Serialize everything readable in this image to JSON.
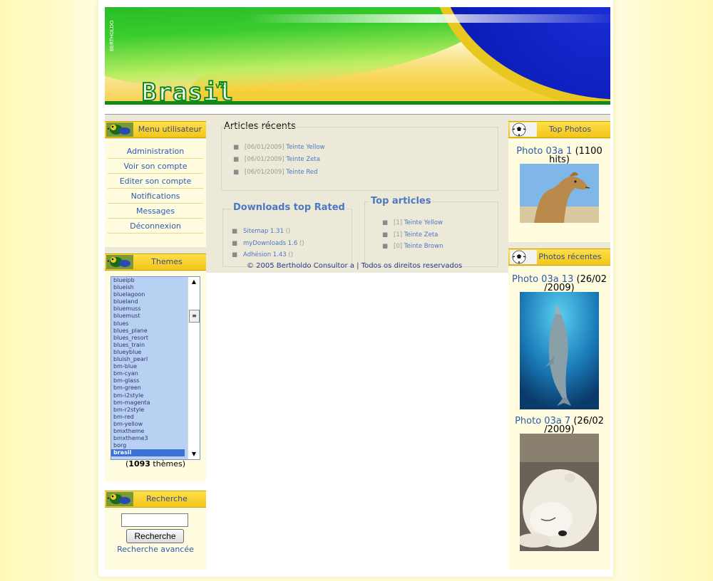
{
  "header": {
    "title": "Brasil",
    "version": "v2",
    "vertical_brand": "BERTHOLDO"
  },
  "user_menu": {
    "title": "Menu utilisateur",
    "items": [
      "Administration",
      "Voir son compte",
      "Editer son compte",
      "Notifications",
      "Messages",
      "Déconnexion"
    ]
  },
  "themes": {
    "title": "Themes",
    "options": [
      "blueipb",
      "blueish",
      "bluelagoon",
      "blueland",
      "bluemuss",
      "bluemust",
      "blues",
      "blues_plane",
      "blues_resort",
      "blues_train",
      "blueyblue",
      "bluish_pearl",
      "bm-blue",
      "bm-cyan",
      "bm-glass",
      "bm-green",
      "bm-i2style",
      "bm-magenta",
      "bm-r2style",
      "bm-red",
      "bm-yellow",
      "bmxtheme",
      "bmxtheme3",
      "borg",
      "brasil"
    ],
    "selected": "brasil",
    "count": "1093",
    "count_suffix": "thèmes"
  },
  "search": {
    "title": "Recherche",
    "input_value": "",
    "button_label": "Recherche",
    "advanced_label": "Recherche avancée"
  },
  "articles_recent": {
    "title": "Articles récents",
    "items": [
      {
        "date": "[06/01/2009]",
        "label": "Teinte Yellow"
      },
      {
        "date": "[06/01/2009]",
        "label": "Teinte Zeta"
      },
      {
        "date": "[06/01/2009]",
        "label": "Teinte Red"
      }
    ]
  },
  "downloads_top": {
    "title": "Downloads top Rated",
    "items": [
      {
        "label": "Sitemap 1.31",
        "rating": "()"
      },
      {
        "label": "myDownloads 1.6",
        "rating": "()"
      },
      {
        "label": "Adhésion 1.43",
        "rating": "()"
      }
    ]
  },
  "top_articles": {
    "title": "Top articles",
    "items": [
      {
        "count": "[1]",
        "label": "Teinte Yellow"
      },
      {
        "count": "[1]",
        "label": "Teinte Zeta"
      },
      {
        "count": "[0]",
        "label": "Teinte Brown"
      }
    ]
  },
  "footer": {
    "copyright": "© 2005 Bertholdo Consultor a | Todos os direitos reservados"
  },
  "top_photos": {
    "title": "Top Photos",
    "photo": {
      "label": "Photo 03a 1",
      "meta_line1": "(1100",
      "meta_line2": "hits)",
      "subject": "camel"
    }
  },
  "recent_photos": {
    "title": "Photos récentes",
    "photos": [
      {
        "label": "Photo 03a 13",
        "meta_line1": "(26/02",
        "meta_line2": "/2009)",
        "subject": "dolphin"
      },
      {
        "label": "Photo 03a 7",
        "meta_line1": "(26/02",
        "meta_line2": "/2009)",
        "subject": "polar bear"
      }
    ]
  },
  "icons": {
    "parrot": "parrot-icon",
    "football": "football-icon"
  },
  "colors": {
    "accent_blue": "#2a5bb0",
    "header_yellow": "#f3c51a",
    "brand_green": "#0b8a17"
  }
}
